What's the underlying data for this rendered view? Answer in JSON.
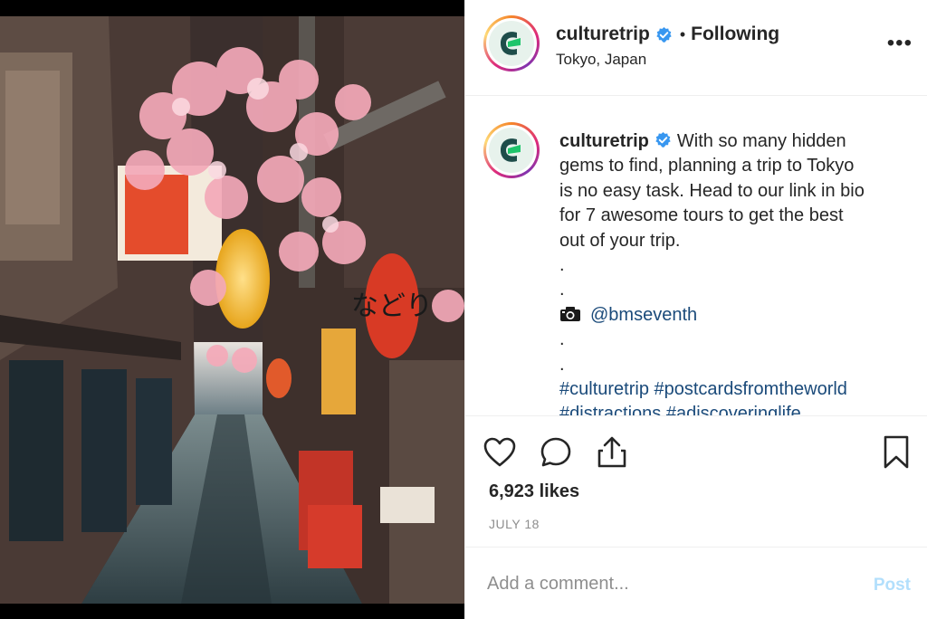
{
  "header": {
    "username": "culturetrip",
    "separator": "•",
    "follow_status": "Following",
    "location": "Tokyo, Japan",
    "more_label": "•••"
  },
  "caption": {
    "username": "culturetrip",
    "lines": [
      "With so many hidden",
      "gems to find, planning a trip to Tokyo",
      "is no easy task. Head to our link in bio",
      "for 7 awesome tours to get the best",
      "out of your trip."
    ],
    "dot1": ".",
    "dot2": ".",
    "credit": "@bmseventh",
    "dot3": ".",
    "dot4": ".",
    "hashtags": "#culturetrip #postcardsfromtheworld",
    "hashtags_cutoff": "#distractions #adiscoveringlife"
  },
  "stats": {
    "likes": "6,923 likes",
    "date": "JULY 18"
  },
  "comment": {
    "placeholder": "Add a comment...",
    "post_label": "Post"
  },
  "colors": {
    "verified_blue": "#3897f0",
    "link": "#1a4a7a",
    "post_disabled": "#b2dffc",
    "muted": "#8e8e8e"
  },
  "icons": [
    "verified-badge-icon",
    "more-options-icon",
    "heart-icon",
    "comment-icon",
    "share-icon",
    "bookmark-icon",
    "camera-icon"
  ]
}
